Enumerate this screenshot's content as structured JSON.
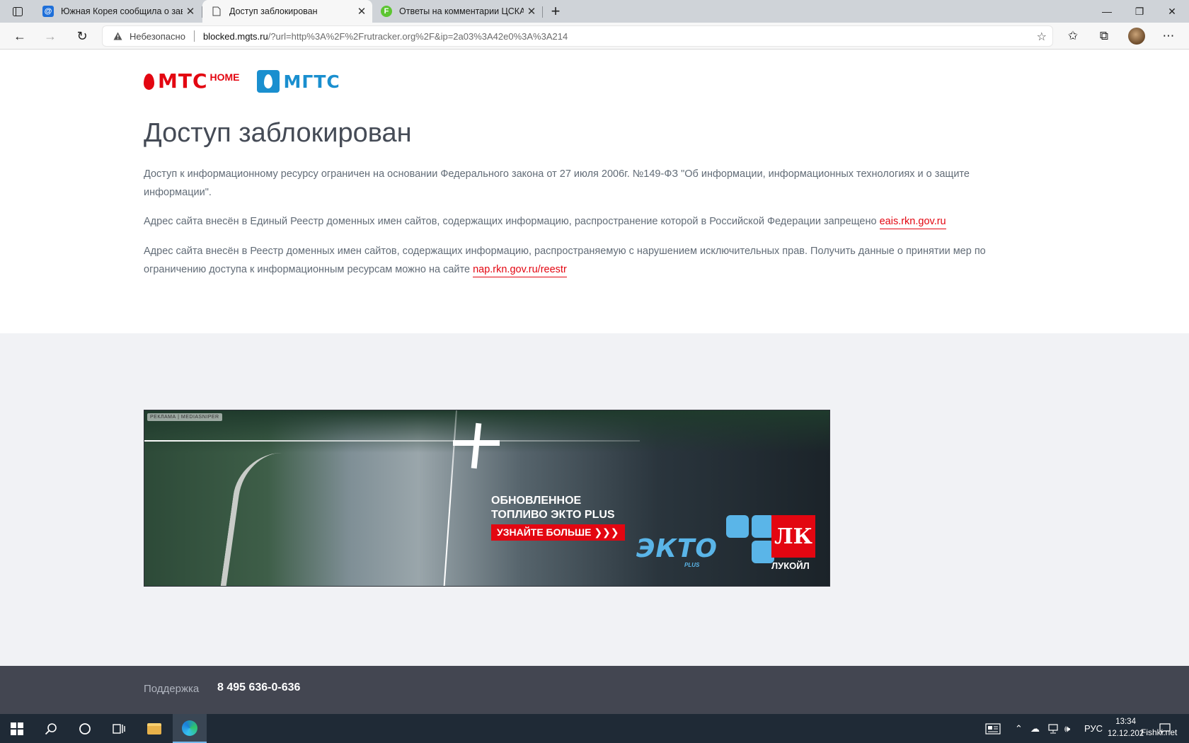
{
  "browser": {
    "tabs": [
      {
        "title": "Южная Корея сообщила о зав",
        "favicon": "@"
      },
      {
        "title": "Доступ заблокирован",
        "favicon": ""
      },
      {
        "title": "Ответы на комментарии ЦСКА",
        "favicon": "F"
      }
    ],
    "insecure_label": "Небезопасно",
    "url_host": "blocked.mgts.ru",
    "url_rest": "/?url=http%3A%2F%2Frutracker.org%2F&ip=2a03%3A42e0%3A%3A214"
  },
  "page": {
    "logos": {
      "mts": "МТС",
      "mts_home": "HOME",
      "mgts": "МГТС"
    },
    "headline": "Доступ заблокирован",
    "paragraph1": "Доступ к информационному ресурсу ограничен на основании Федерального закона от 27 июля 2006г. №149-ФЗ \"Об информации, информационных технологиях и о защите информации\".",
    "paragraph2_text": "Адрес сайта внесён в Единый Реестр доменных имен сайтов, содержащих информацию, распространение которой в Российской Федерации запрещено ",
    "paragraph2_link": "eais.rkn.gov.ru",
    "paragraph3_text": "Адрес сайта внесён в Реестр доменных имен сайтов, содержащих информацию, распространяемую с нарушением исключительных прав. Получить данные о принятии мер по ограничению доступа к информационным ресурсам можно на сайте ",
    "paragraph3_link": "nap.rkn.gov.ru/reestr"
  },
  "ad": {
    "tag": "РЕКЛАМА | MEDIASNIPER",
    "headline_line1": "ОБНОВЛЕННОЕ",
    "headline_line2": "ТОПЛИВО ЭКТО PLUS",
    "cta": "УЗНАЙТЕ БОЛЬШЕ ❯❯❯",
    "ekto": "ЭКТО",
    "ekto_sub": "PLUS",
    "lukoil_mark": "ЛК",
    "lukoil": "ЛУКОЙЛ"
  },
  "footer": {
    "support_label": "Поддержка",
    "support_phone": "8 495 636-0-636"
  },
  "taskbar": {
    "language": "РУС",
    "time": "13:34",
    "date": "12.12.202",
    "watermark": "Fishki.net"
  },
  "colors": {
    "brand_red": "#e30611",
    "mgts_blue": "#1a8fcf",
    "footer_bg": "#434651"
  }
}
